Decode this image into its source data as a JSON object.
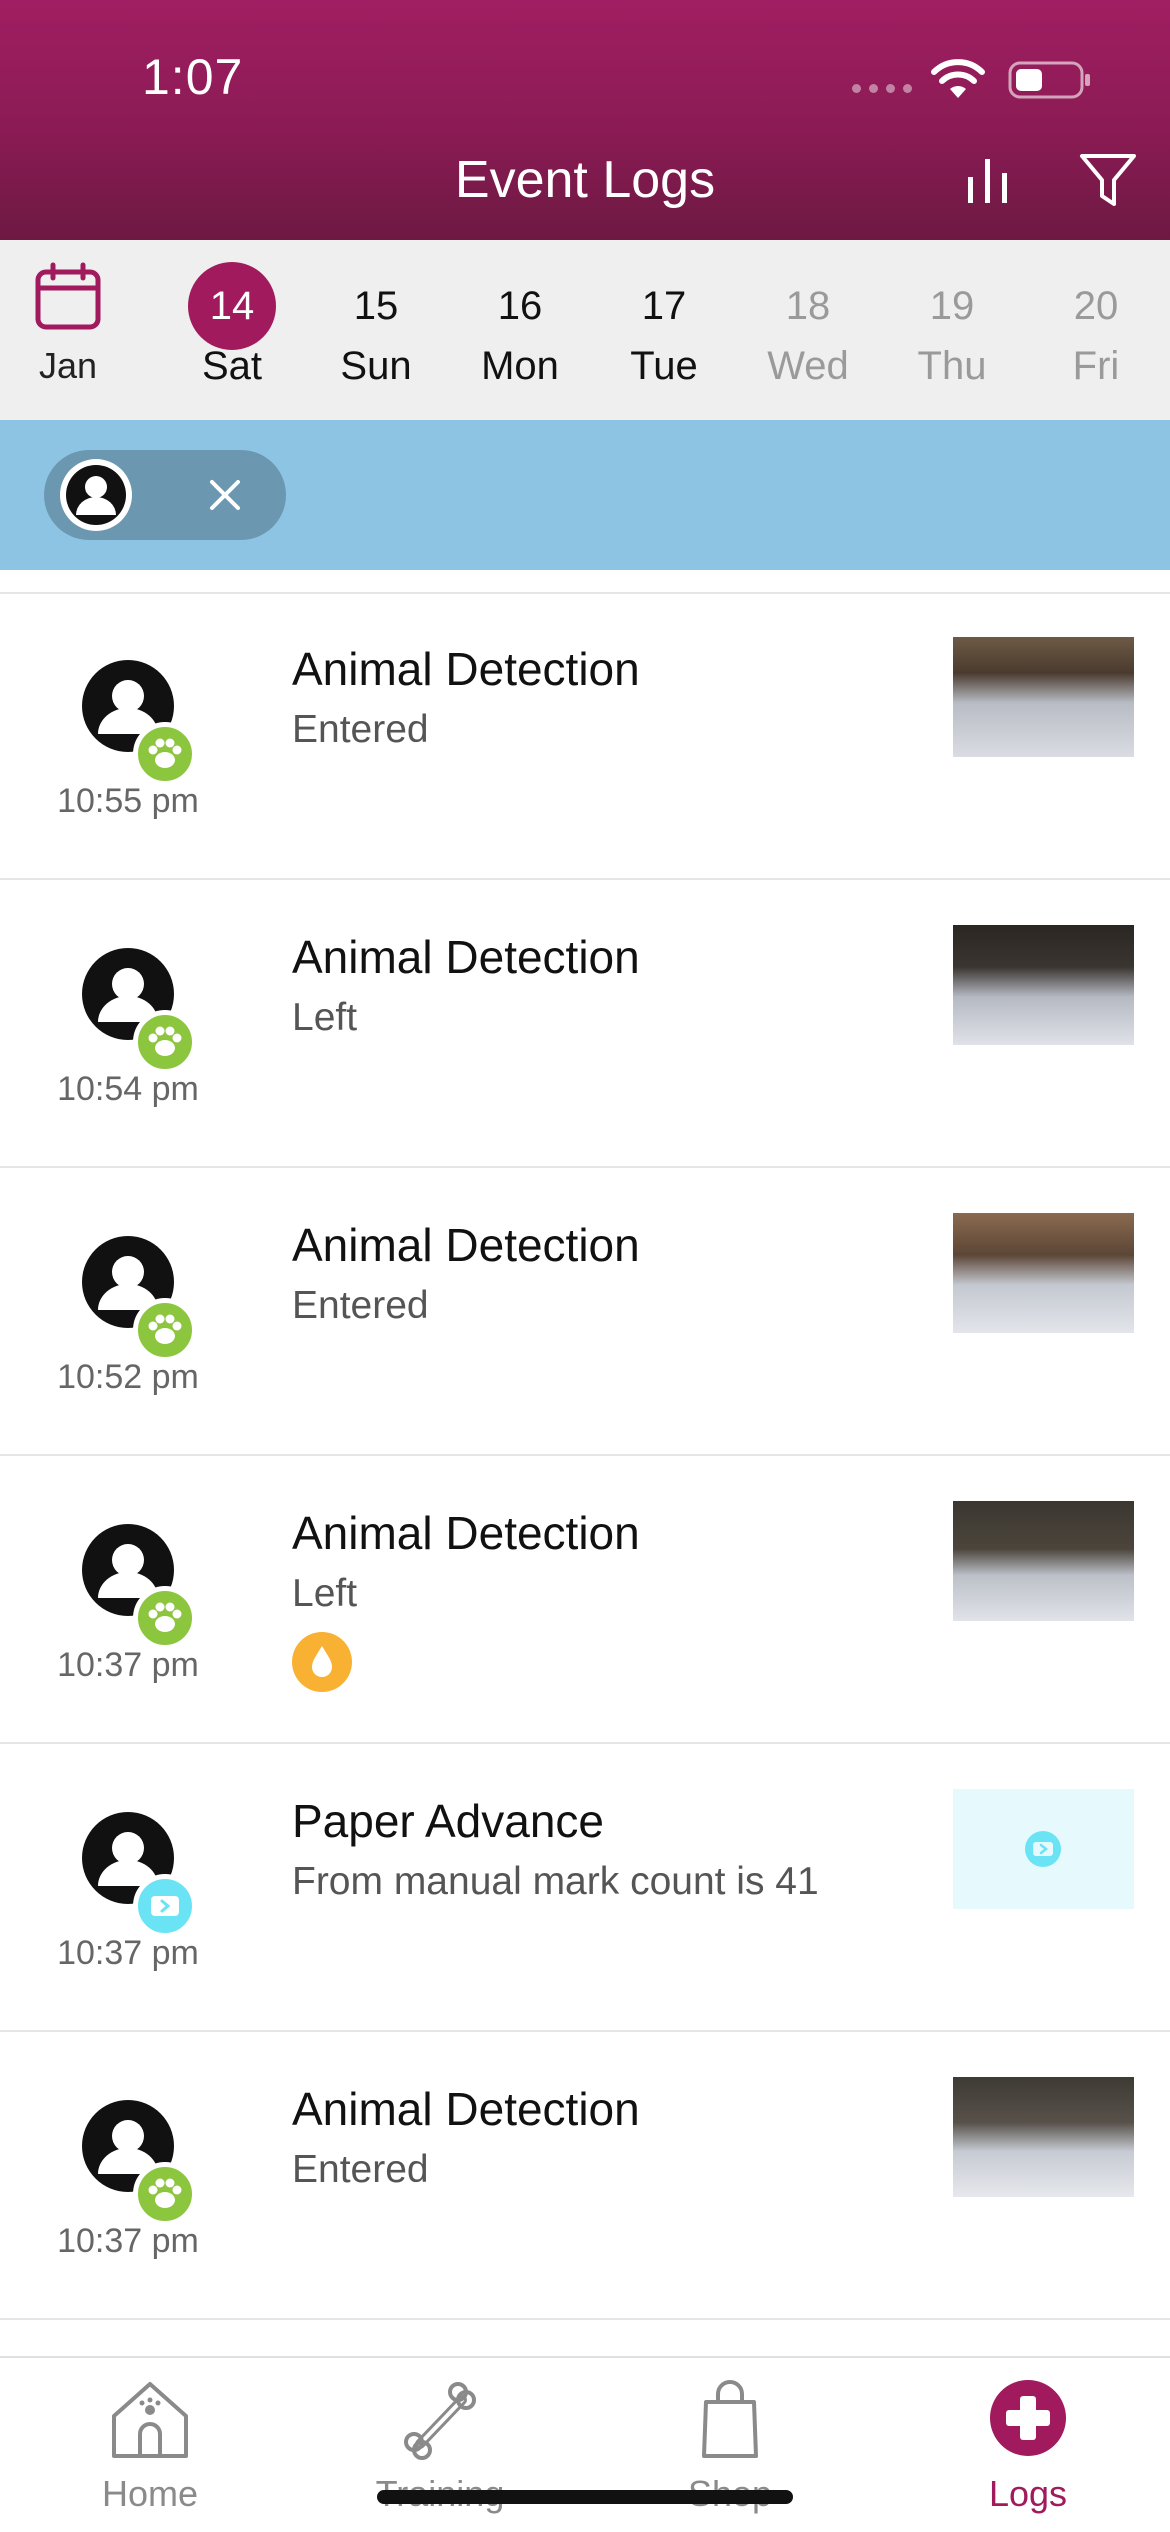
{
  "status_bar": {
    "time": "1:07"
  },
  "header": {
    "title": "Event Logs",
    "stats_icon": "bar-chart-icon",
    "filter_icon": "funnel-icon"
  },
  "date_strip": {
    "calendar_label": "Jan",
    "days": [
      {
        "num": "14",
        "name": "Sat",
        "selected": true
      },
      {
        "num": "15",
        "name": "Sun"
      },
      {
        "num": "16",
        "name": "Mon"
      },
      {
        "num": "17",
        "name": "Tue"
      },
      {
        "num": "18",
        "name": "Wed",
        "disabled": true
      },
      {
        "num": "19",
        "name": "Thu",
        "disabled": true
      },
      {
        "num": "20",
        "name": "Fri",
        "disabled": true
      }
    ]
  },
  "filter_chip": {
    "avatar_icon": "user-avatar-icon",
    "close_icon": "close-icon"
  },
  "events": [
    {
      "title": "Animal Detection",
      "subtitle": "Entered",
      "time": "10:55 pm",
      "badge": "paw-icon"
    },
    {
      "title": "Animal Detection",
      "subtitle": "Left",
      "time": "10:54 pm",
      "badge": "paw-icon"
    },
    {
      "title": "Animal Detection",
      "subtitle": "Entered",
      "time": "10:52 pm",
      "badge": "paw-icon"
    },
    {
      "title": "Animal Detection",
      "subtitle": "Left",
      "time": "10:37 pm",
      "badge": "paw-icon",
      "extra_icon": "water-drop-icon"
    },
    {
      "title": "Paper Advance",
      "subtitle": "From manual mark count is 41",
      "time": "10:37 pm",
      "badge": "paper-advance-icon"
    },
    {
      "title": "Animal Detection",
      "subtitle": "Entered",
      "time": "10:37 pm",
      "badge": "paw-icon"
    }
  ],
  "tabbar": {
    "tabs": [
      {
        "label": "Home",
        "icon": "home-icon"
      },
      {
        "label": "Training",
        "icon": "bone-icon"
      },
      {
        "label": "Shop",
        "icon": "shopping-bag-icon"
      },
      {
        "label": "Logs",
        "icon": "medical-cross-icon",
        "active": true
      }
    ]
  },
  "colors": {
    "brand": "#a01a5d",
    "filter_bar": "#8dc4e4",
    "paw_badge": "#8cc63f",
    "paper_badge": "#6ae3f4",
    "drop_badge": "#f8b133"
  }
}
